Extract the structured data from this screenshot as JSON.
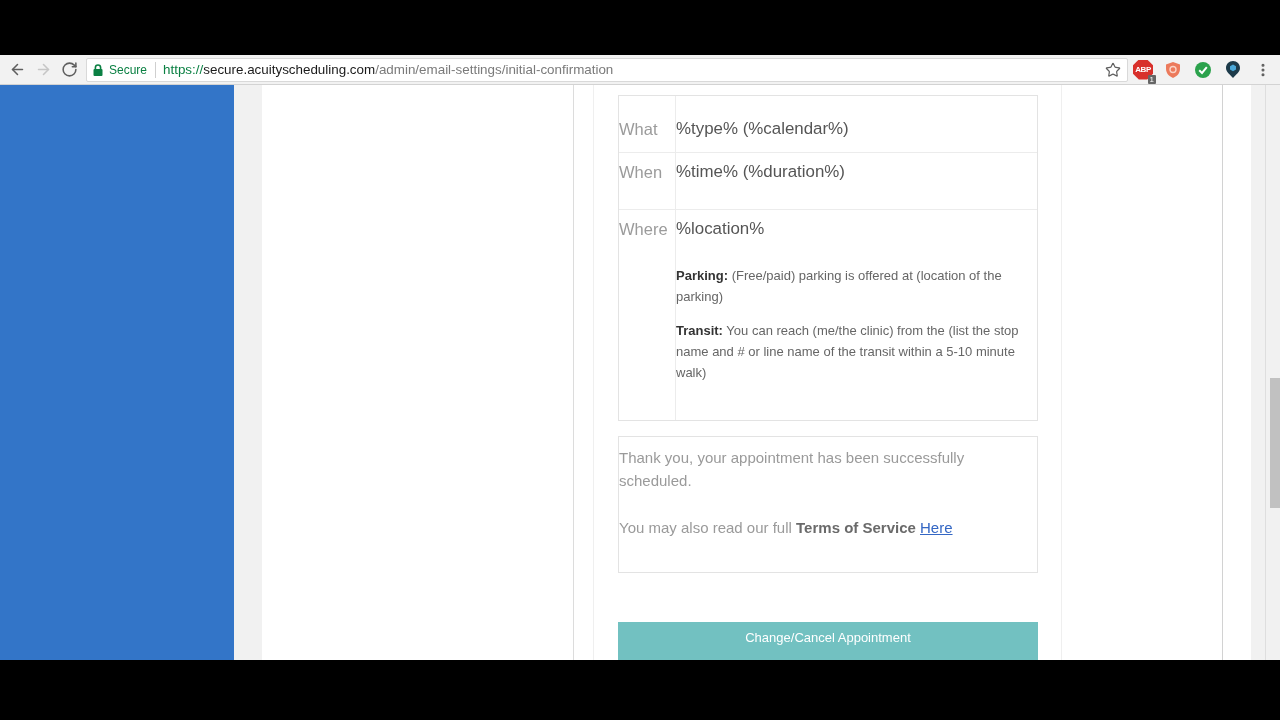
{
  "browser": {
    "nav_buttons": [
      {
        "kind": "back",
        "disabled": false
      },
      {
        "kind": "forward",
        "disabled": true
      },
      {
        "kind": "reload",
        "disabled": false
      }
    ],
    "address_bar": {
      "security_label": "Secure",
      "url_scheme": "https://",
      "url_host": "secure.acuityscheduling.com",
      "url_path": "/admin/email-settings/initial-confirmation"
    },
    "extensions": [
      {
        "kind": "adblock",
        "label": "ABP",
        "badge": "1"
      },
      {
        "kind": "shield"
      },
      {
        "kind": "check"
      },
      {
        "kind": "pin"
      }
    ]
  },
  "email_preview": {
    "details": [
      {
        "label": "What",
        "value": "%type% (%calendar%)"
      },
      {
        "label": "When",
        "value": "%time% (%duration%)"
      },
      {
        "label": "Where",
        "value": "%location%",
        "notes": [
          "**Parking:** (Free/paid) parking is offered at (location of the parking)",
          "**Transit:** You can reach (me/the clinic) from the (list the stop name and # or line name of the transit within a 5-10 minute walk)"
        ]
      }
    ],
    "message": {
      "confirmation": "Thank you, your appointment has been successfully scheduled.",
      "terms_text": "You may also read our full **Terms of Service**",
      "terms_link": "Here"
    },
    "action_button": "Change/Cancel Appointment"
  }
}
